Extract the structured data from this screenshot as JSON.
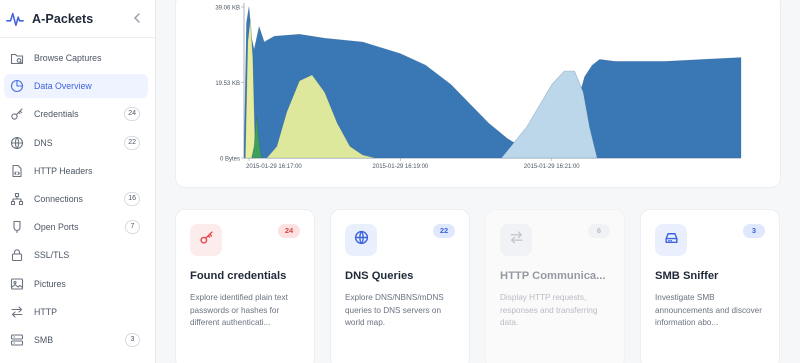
{
  "app": {
    "title": "A-Packets"
  },
  "sidebar": {
    "items": [
      {
        "label": "Browse Captures",
        "icon": "folder-search-icon",
        "count": null,
        "active": false
      },
      {
        "label": "Data Overview",
        "icon": "pie-chart-icon",
        "count": null,
        "active": true
      },
      {
        "label": "Credentials",
        "icon": "key-icon",
        "count": "24",
        "active": false
      },
      {
        "label": "DNS",
        "icon": "globe-icon",
        "count": "22",
        "active": false
      },
      {
        "label": "HTTP Headers",
        "icon": "file-code-icon",
        "count": null,
        "active": false
      },
      {
        "label": "Connections",
        "icon": "network-icon",
        "count": "16",
        "active": false
      },
      {
        "label": "Open Ports",
        "icon": "plug-icon",
        "count": "7",
        "active": false
      },
      {
        "label": "SSL/TLS",
        "icon": "lock-icon",
        "count": null,
        "active": false
      },
      {
        "label": "Pictures",
        "icon": "image-icon",
        "count": null,
        "active": false
      },
      {
        "label": "HTTP",
        "icon": "arrows-swap-icon",
        "count": null,
        "active": false
      },
      {
        "label": "SMB",
        "icon": "server-icon",
        "count": "3",
        "active": false
      }
    ]
  },
  "chart_data": {
    "type": "area",
    "y_ticks": [
      "39.06 KB",
      "19.53 KB",
      "0 Bytes"
    ],
    "x_ticks": [
      "2015-01-29 16:17:00",
      "2015-01-29 16:19:00",
      "2015-01-29 16:21:00"
    ],
    "x_range": [
      "2015-01-29 16:16:56",
      "2015-01-29 16:23:30"
    ],
    "y_range_kb": [
      0,
      39.06
    ],
    "series": [
      {
        "color": "#3a78b5",
        "x": [
          "16:16:56",
          "16:16:58",
          "16:17:00",
          "16:17:02",
          "16:17:04",
          "16:17:08",
          "16:17:12",
          "16:17:20",
          "16:17:40",
          "16:18:00",
          "16:18:30",
          "16:19:00",
          "16:19:20",
          "16:19:40",
          "16:19:55",
          "16:20:10",
          "16:20:25",
          "16:20:40",
          "16:20:50",
          "16:21:00",
          "16:21:10",
          "16:21:20",
          "16:21:26",
          "16:21:32",
          "16:21:38",
          "16:21:50",
          "16:22:30",
          "16:23:00",
          "16:23:30"
        ],
        "kb": [
          0,
          35,
          39.1,
          31,
          28,
          34,
          30,
          31.5,
          32,
          31,
          30,
          27,
          24,
          19,
          14,
          9,
          5,
          2,
          1,
          2.5,
          7,
          14,
          21,
          24,
          25.5,
          25,
          25,
          25.5,
          26
        ]
      },
      {
        "color": "#bcd7ea",
        "x": [
          "16:20:20",
          "16:20:40",
          "16:21:00",
          "16:21:10",
          "16:21:18",
          "16:21:25",
          "16:21:30",
          "16:21:36"
        ],
        "kb": [
          0,
          8,
          19,
          22.5,
          22.5,
          17,
          8,
          0
        ]
      },
      {
        "color": "#dde89c",
        "x": [
          "16:17:14",
          "16:17:22",
          "16:17:30",
          "16:17:40",
          "16:17:50",
          "16:18:00",
          "16:18:10",
          "16:18:20",
          "16:18:30",
          "16:18:40"
        ],
        "kb": [
          0,
          3,
          12,
          20,
          21.5,
          17,
          9,
          3,
          0.8,
          0
        ]
      },
      {
        "color": "#e7ed9c",
        "x": [
          "16:16:57",
          "16:16:59",
          "16:17:01",
          "16:17:03",
          "16:17:05"
        ],
        "kb": [
          0,
          30,
          36,
          26,
          0
        ]
      },
      {
        "color": "#3c9f5b",
        "x": [
          "16:17:02",
          "16:17:04",
          "16:17:06",
          "16:17:08",
          "16:17:10"
        ],
        "kb": [
          0,
          3,
          11,
          4,
          0
        ]
      }
    ]
  },
  "cards": [
    {
      "title": "Found credentials",
      "badge": "24",
      "icon": "key-icon",
      "desc": "Explore identified plain text passwords or hashes for different authenticati...",
      "icon_bg": "#fdecec",
      "icon_color": "#e5484d",
      "badge_bg": "#fde1e1",
      "badge_color": "#d64545"
    },
    {
      "title": "DNS Queries",
      "badge": "22",
      "icon": "globe-icon",
      "desc": "Explore DNS/NBNS/mDNS queries to DNS servers on world map.",
      "icon_bg": "#e9effd",
      "icon_color": "#3d63dd",
      "badge_bg": "#dfe8fd",
      "badge_color": "#3d63dd"
    },
    {
      "title": "HTTP Communica...",
      "badge": "6",
      "icon": "arrows-swap-icon",
      "desc": "Display HTTP requests, responses and transferring data.",
      "icon_bg": "#eceef1",
      "icon_color": "#8a9099",
      "badge_bg": "#eceef1",
      "badge_color": "#6b7280"
    },
    {
      "title": "SMB Sniffer",
      "badge": "3",
      "icon": "hard-drive-icon",
      "desc": "Investigate SMB announcements and discover information abo...",
      "icon_bg": "#e9effd",
      "icon_color": "#3d63dd",
      "badge_bg": "#dfe8fd",
      "badge_color": "#3d63dd"
    }
  ]
}
